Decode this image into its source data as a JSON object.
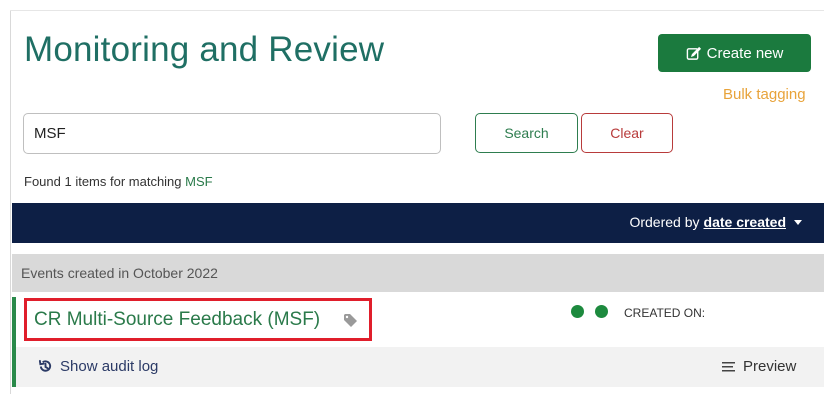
{
  "header": {
    "title": "Monitoring and Review",
    "create_button_label": "Create new",
    "bulk_tagging_label": "Bulk tagging"
  },
  "search": {
    "value": "MSF",
    "search_label": "Search",
    "clear_label": "Clear",
    "result_prefix": "Found 1 items for matching",
    "result_term": "MSF"
  },
  "ordering": {
    "prefix": "Ordered by",
    "field": "date created"
  },
  "groups": [
    {
      "label": "Events created in October 2022",
      "events": [
        {
          "title": "CR Multi-Source Feedback (MSF)",
          "created_label": "CREATED ON:",
          "audit_label": "Show audit log",
          "preview_label": "Preview"
        }
      ]
    }
  ],
  "colors": {
    "title": "#1f6f64",
    "create_button": "#1b7a3e",
    "bulk_link": "#e8a33a",
    "order_bar": "#0d1f45",
    "highlight_box": "#e01e2b",
    "status_dot": "#1d8a3e"
  },
  "icons": {
    "create": "edit-icon",
    "tag": "tag-icon",
    "audit": "history-icon",
    "preview": "list-icon"
  }
}
